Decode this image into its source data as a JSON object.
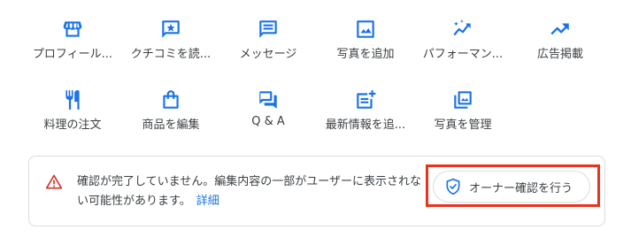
{
  "actions_row1": [
    {
      "icon": "storefront-icon",
      "label": "プロフィール..."
    },
    {
      "icon": "review-star-icon",
      "label": "クチコミを読..."
    },
    {
      "icon": "message-icon",
      "label": "メッセージ"
    },
    {
      "icon": "photo-icon",
      "label": "写真を追加"
    },
    {
      "icon": "performance-trend-icon",
      "label": "パフォーマン..."
    },
    {
      "icon": "ads-trend-icon",
      "label": "広告掲載"
    }
  ],
  "actions_row2": [
    {
      "icon": "restaurant-icon",
      "label": "料理の注文"
    },
    {
      "icon": "shopping-bag-icon",
      "label": "商品を編集"
    },
    {
      "icon": "qa-chat-icon",
      "label": "Q & A"
    },
    {
      "icon": "post-add-icon",
      "label": "最新情報を追..."
    },
    {
      "icon": "photo-library-icon",
      "label": "写真を管理"
    }
  ],
  "notice": {
    "message": "確認が完了していません。編集内容の一部がユーザーに表示されない可能性があります。",
    "link": "詳細",
    "button": "オーナー確認を行う"
  },
  "colors": {
    "icon_blue": "#1a73e8",
    "warning_red": "#d93025",
    "highlight_red": "#e8341c",
    "link_blue": "#1a73e8"
  }
}
